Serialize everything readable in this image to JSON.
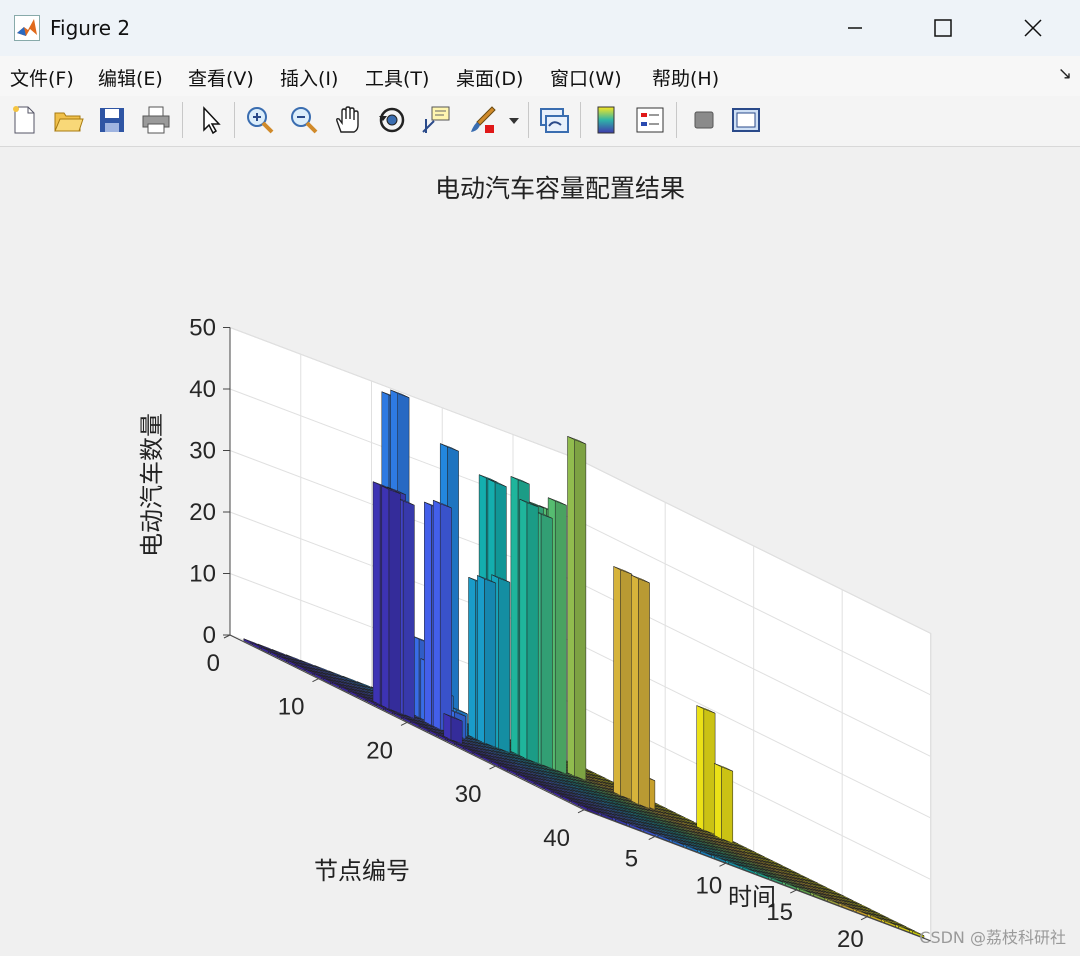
{
  "window": {
    "title": "Figure 2",
    "minimize_icon": "minimize-icon",
    "maximize_icon": "maximize-icon",
    "close_icon": "close-icon"
  },
  "menu": {
    "items": [
      "文件(F)",
      "编辑(E)",
      "查看(V)",
      "插入(I)",
      "工具(T)",
      "桌面(D)",
      "窗口(W)",
      "帮助(H)"
    ],
    "corner_icon": "dock-arrow-icon"
  },
  "toolbar": {
    "icons": [
      "new-figure-icon",
      "open-file-icon",
      "save-icon",
      "print-icon",
      "pointer-icon",
      "zoom-in-icon",
      "zoom-out-icon",
      "pan-hand-icon",
      "rotate-3d-icon",
      "data-cursor-icon",
      "brush-icon",
      "dropdown-arrow-icon",
      "link-plot-icon",
      "colorbar-icon",
      "legend-icon",
      "hide-plot-tools-icon",
      "show-plot-tools-icon"
    ]
  },
  "watermark": "CSDN @荔枝科研社",
  "chart_data": {
    "type": "bar3",
    "title": "电动汽车容量配置结果",
    "xlabel": "时间",
    "ylabel": "节点编号",
    "zlabel": "电动汽车数量",
    "x_ticks": [
      5,
      10,
      15,
      20
    ],
    "y_ticks": [
      0,
      10,
      20,
      30,
      40
    ],
    "z_ticks": [
      0,
      10,
      20,
      30,
      40,
      50
    ],
    "xlim": [
      0.5,
      24.5
    ],
    "ylim": [
      0,
      40
    ],
    "zlim": [
      0,
      50
    ],
    "colormap": "parula",
    "grid": true,
    "baseline_value": 0,
    "bars": [
      {
        "time": 2,
        "node": 14,
        "value": 36
      },
      {
        "time": 2,
        "node": 15,
        "value": 36
      },
      {
        "time": 2,
        "node": 22,
        "value": 4
      },
      {
        "time": 3,
        "node": 14,
        "value": 36
      },
      {
        "time": 3,
        "node": 15,
        "value": 35
      },
      {
        "time": 5,
        "node": 15,
        "value": 36
      },
      {
        "time": 5,
        "node": 16,
        "value": 37
      },
      {
        "time": 6,
        "node": 12,
        "value": 13
      },
      {
        "time": 6,
        "node": 13,
        "value": 10
      },
      {
        "time": 6,
        "node": 16,
        "value": 4
      },
      {
        "time": 7,
        "node": 7,
        "value": 50
      },
      {
        "time": 7,
        "node": 8,
        "value": 51
      },
      {
        "time": 7,
        "node": 13,
        "value": 6
      },
      {
        "time": 8,
        "node": 12,
        "value": 46
      },
      {
        "time": 8,
        "node": 13,
        "value": 4
      },
      {
        "time": 10,
        "node": 12,
        "value": 26
      },
      {
        "time": 10,
        "node": 13,
        "value": 27
      },
      {
        "time": 11,
        "node": 12,
        "value": 25
      },
      {
        "time": 11,
        "node": 13,
        "value": 28
      },
      {
        "time": 12,
        "node": 10,
        "value": 43
      },
      {
        "time": 12,
        "node": 11,
        "value": 43
      },
      {
        "time": 13,
        "node": 12,
        "value": 45
      },
      {
        "time": 13,
        "node": 13,
        "value": 42
      },
      {
        "time": 14,
        "node": 12,
        "value": 42
      },
      {
        "time": 14,
        "node": 13,
        "value": 41
      },
      {
        "time": 15,
        "node": 12,
        "value": 42
      },
      {
        "time": 15,
        "node": 13,
        "value": 44
      },
      {
        "time": 17,
        "node": 12,
        "value": 55
      },
      {
        "time": 17,
        "node": 9,
        "value": 10
      },
      {
        "time": 19,
        "node": 14,
        "value": 37
      },
      {
        "time": 19,
        "node": 16,
        "value": 37
      },
      {
        "time": 20,
        "node": 15,
        "value": 5
      },
      {
        "time": 23,
        "node": 17,
        "value": 20
      },
      {
        "time": 23,
        "node": 19,
        "value": 12
      }
    ]
  }
}
